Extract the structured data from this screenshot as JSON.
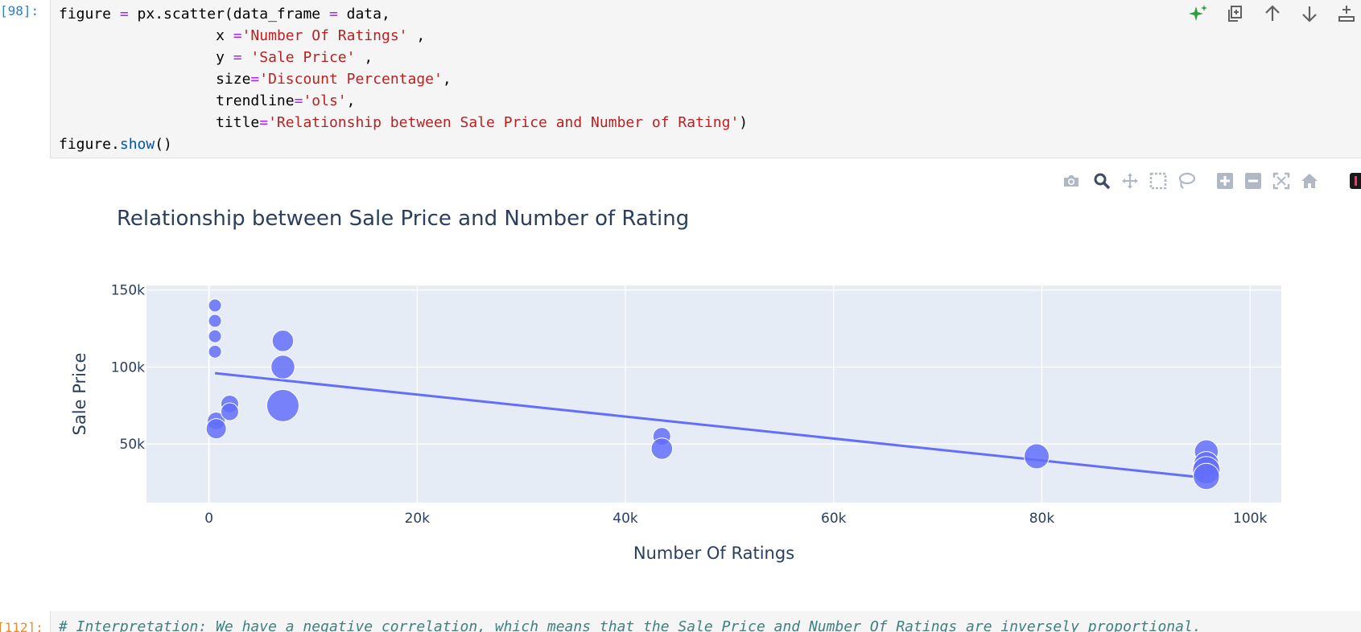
{
  "cells": {
    "top": {
      "prompt": "[98]:",
      "code_lines": [
        [
          {
            "t": "figure "
          },
          {
            "t": "=",
            "c": "op"
          },
          {
            "t": " px.scatter(data_frame "
          },
          {
            "t": "=",
            "c": "op"
          },
          {
            "t": " data,"
          }
        ],
        [
          {
            "t": "                  x "
          },
          {
            "t": "=",
            "c": "op"
          },
          {
            "t": "'Number Of Ratings'",
            "c": "str"
          },
          {
            "t": " ,"
          }
        ],
        [
          {
            "t": "                  y "
          },
          {
            "t": "=",
            "c": "op"
          },
          {
            "t": " "
          },
          {
            "t": "'Sale Price'",
            "c": "str"
          },
          {
            "t": " ,"
          }
        ],
        [
          {
            "t": "                  size"
          },
          {
            "t": "=",
            "c": "op"
          },
          {
            "t": "'Discount Percentage'",
            "c": "str"
          },
          {
            "t": ","
          }
        ],
        [
          {
            "t": "                  trendline"
          },
          {
            "t": "=",
            "c": "op"
          },
          {
            "t": "'ols'",
            "c": "str"
          },
          {
            "t": ","
          }
        ],
        [
          {
            "t": "                  title"
          },
          {
            "t": "=",
            "c": "op"
          },
          {
            "t": "'Relationship between Sale Price and Number of Rating'",
            "c": "str"
          },
          {
            "t": ")"
          }
        ],
        [
          {
            "t": "figure."
          },
          {
            "t": "show",
            "c": "fn"
          },
          {
            "t": "()"
          }
        ]
      ]
    },
    "bottom": {
      "prompt": "[112]:",
      "comment": "# Interpretation: We have a negative correlation, which means that the Sale Price and Number Of Ratings are inversely proportional."
    }
  },
  "cell_toolbar": {
    "icons": [
      "sparkle-icon",
      "duplicate-icon",
      "move-up-icon",
      "move-down-icon",
      "insert-above-icon",
      "insert-below-icon"
    ],
    "accent": "#2e9e3e"
  },
  "modebar": {
    "icons": [
      "camera-icon",
      "zoom-icon",
      "pan-icon",
      "box-select-icon",
      "lasso-icon",
      "zoom-in-icon",
      "zoom-out-icon",
      "autoscale-icon",
      "reset-axes-icon",
      "plotly-logo-icon"
    ]
  },
  "chart_data": {
    "type": "scatter",
    "title": "Relationship between Sale Price and Number of Rating",
    "xlabel": "Number Of Ratings",
    "ylabel": "Sale Price",
    "xlim": [
      -6000,
      103000
    ],
    "ylim": [
      12000,
      153000
    ],
    "xticks": [
      0,
      20000,
      40000,
      60000,
      80000,
      100000
    ],
    "xtick_labels": [
      "0",
      "20k",
      "40k",
      "60k",
      "80k",
      "100k"
    ],
    "yticks": [
      50000,
      100000,
      150000
    ],
    "ytick_labels": [
      "50k",
      "100k",
      "150k"
    ],
    "grid": true,
    "plot_bgcolor": "#e5ecf6",
    "marker_color": "#636efa",
    "points": [
      {
        "x": 580,
        "y": 140000,
        "size": 4
      },
      {
        "x": 580,
        "y": 130000,
        "size": 4
      },
      {
        "x": 580,
        "y": 120000,
        "size": 4
      },
      {
        "x": 580,
        "y": 110000,
        "size": 4
      },
      {
        "x": 700,
        "y": 65000,
        "size": 8
      },
      {
        "x": 700,
        "y": 60000,
        "size": 10
      },
      {
        "x": 2000,
        "y": 76000,
        "size": 8
      },
      {
        "x": 2000,
        "y": 71000,
        "size": 8
      },
      {
        "x": 7100,
        "y": 117000,
        "size": 11
      },
      {
        "x": 7100,
        "y": 100000,
        "size": 13
      },
      {
        "x": 7100,
        "y": 75000,
        "size": 20
      },
      {
        "x": 43500,
        "y": 55000,
        "size": 8
      },
      {
        "x": 43500,
        "y": 47000,
        "size": 11
      },
      {
        "x": 79500,
        "y": 42000,
        "size": 14
      },
      {
        "x": 95800,
        "y": 45000,
        "size": 13
      },
      {
        "x": 95800,
        "y": 37000,
        "size": 14
      },
      {
        "x": 95800,
        "y": 33000,
        "size": 16
      },
      {
        "x": 95800,
        "y": 29000,
        "size": 15
      }
    ],
    "trendline": {
      "x": [
        580,
        95800
      ],
      "y": [
        96000,
        28000
      ]
    }
  }
}
